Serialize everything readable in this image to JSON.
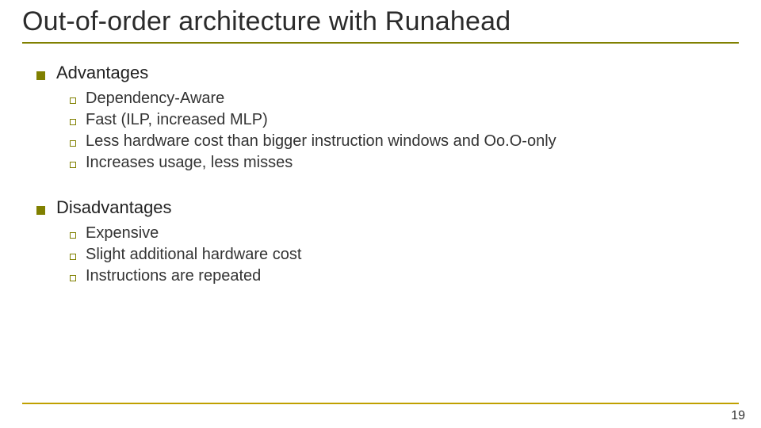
{
  "title": "Out-of-order architecture with Runahead",
  "page_number": "19",
  "sections": [
    {
      "heading": "Advantages",
      "items": [
        "Dependency-Aware",
        "Fast (ILP, increased MLP)",
        "Less hardware cost than bigger instruction windows and Oo.O-only",
        "Increases usage, less misses"
      ]
    },
    {
      "heading": "Disadvantages",
      "items": [
        "Expensive",
        "Slight additional hardware cost",
        "Instructions are repeated"
      ]
    }
  ]
}
